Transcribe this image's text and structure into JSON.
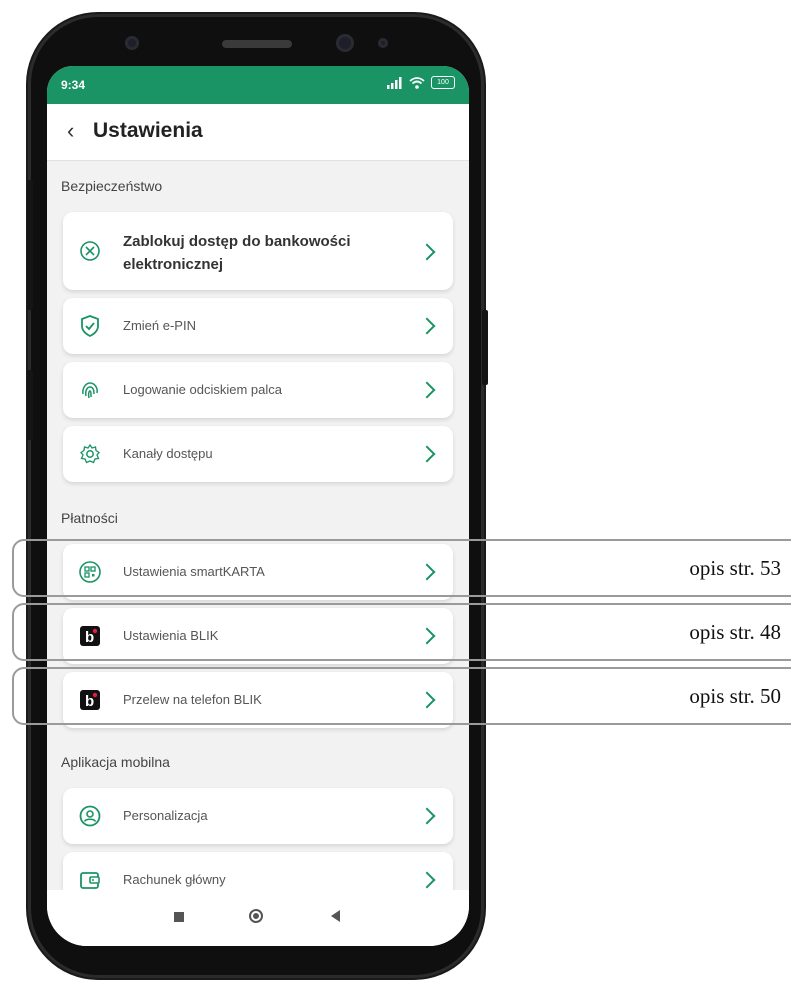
{
  "status": {
    "time": "9:34",
    "battery": "100"
  },
  "header": {
    "title": "Ustawienia"
  },
  "sections": [
    {
      "title": "Bezpieczeństwo",
      "items": [
        {
          "label": "Zablokuj dostęp do bankowości elektronicznej",
          "icon": "block-icon"
        },
        {
          "label": "Zmień e-PIN",
          "icon": "shield-check-icon"
        },
        {
          "label": "Logowanie odciskiem palca",
          "icon": "fingerprint-icon"
        },
        {
          "label": "Kanały dostępu",
          "icon": "gear-icon"
        }
      ]
    },
    {
      "title": "Płatności",
      "items": [
        {
          "label": "Ustawienia smartKARTA",
          "icon": "qr-icon"
        },
        {
          "label": "Ustawienia BLIK",
          "icon": "blik-icon"
        },
        {
          "label": "Przelew na telefon BLIK",
          "icon": "blik-icon"
        }
      ]
    },
    {
      "title": "Aplikacja mobilna",
      "items": [
        {
          "label": "Personalizacja",
          "icon": "user-circle-icon"
        },
        {
          "label": "Rachunek główny",
          "icon": "wallet-icon"
        }
      ]
    }
  ],
  "notes": [
    "opis str. 53",
    "opis str. 48",
    "opis str. 50"
  ],
  "colors": {
    "accent": "#1a9464"
  }
}
